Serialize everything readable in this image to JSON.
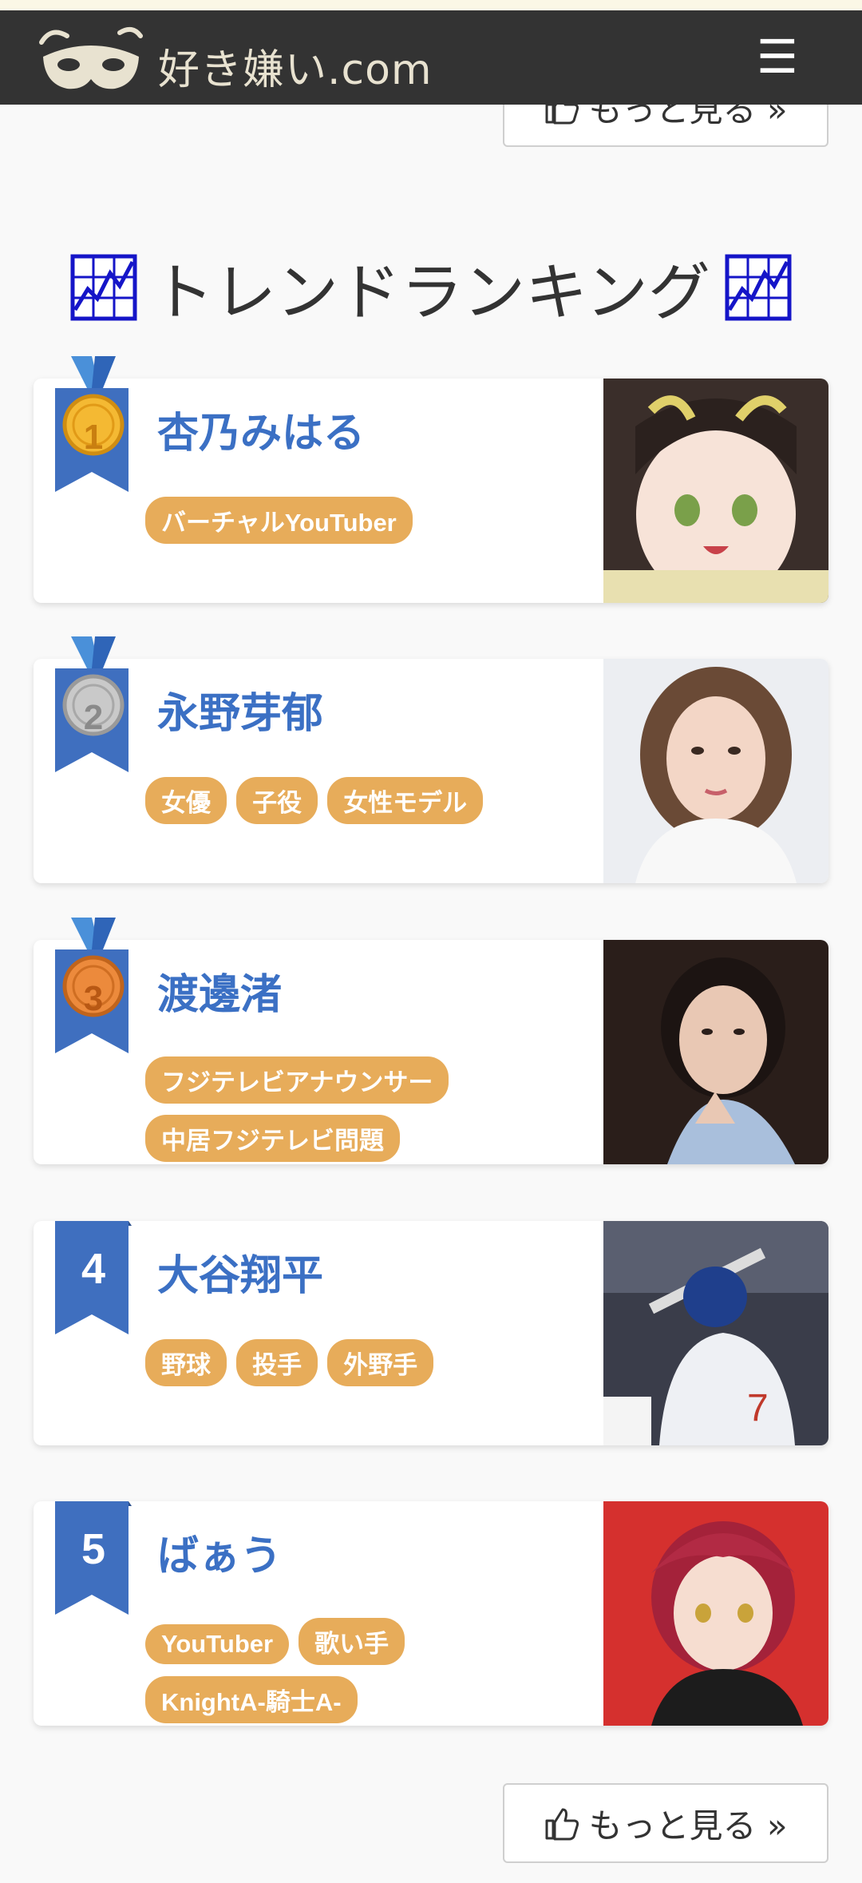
{
  "header": {
    "logo_text": "好き嫌い.com",
    "menu_icon": "hamburger-menu-icon"
  },
  "more_button": {
    "label": "もっと見る »",
    "icon": "thumbs-up-icon"
  },
  "section": {
    "title": "トレンドランキング",
    "icon": "chart-icon"
  },
  "rankings": [
    {
      "rank": "1",
      "name": "杏乃みはる",
      "tags": [
        "バーチャルYouTuber"
      ],
      "badge": "gold-medal-icon"
    },
    {
      "rank": "2",
      "name": "永野芽郁",
      "tags": [
        "女優",
        "子役",
        "女性モデル"
      ],
      "badge": "silver-medal-icon"
    },
    {
      "rank": "3",
      "name": "渡邊渚",
      "tags": [
        "フジテレビアナウンサー",
        "中居フジテレビ問題"
      ],
      "badge": "bronze-medal-icon"
    },
    {
      "rank": "4",
      "name": "大谷翔平",
      "tags": [
        "野球",
        "投手",
        "外野手"
      ],
      "badge": "rank-ribbon-icon"
    },
    {
      "rank": "5",
      "name": "ばぁう",
      "tags": [
        "YouTuber",
        "歌い手",
        "KnightA-騎士A-"
      ],
      "badge": "rank-ribbon-icon"
    }
  ],
  "colors": {
    "header_bg": "#333333",
    "name": "#3b70c4",
    "tag_bg": "#e7ac5a",
    "ribbon": "#3f6fbf"
  }
}
